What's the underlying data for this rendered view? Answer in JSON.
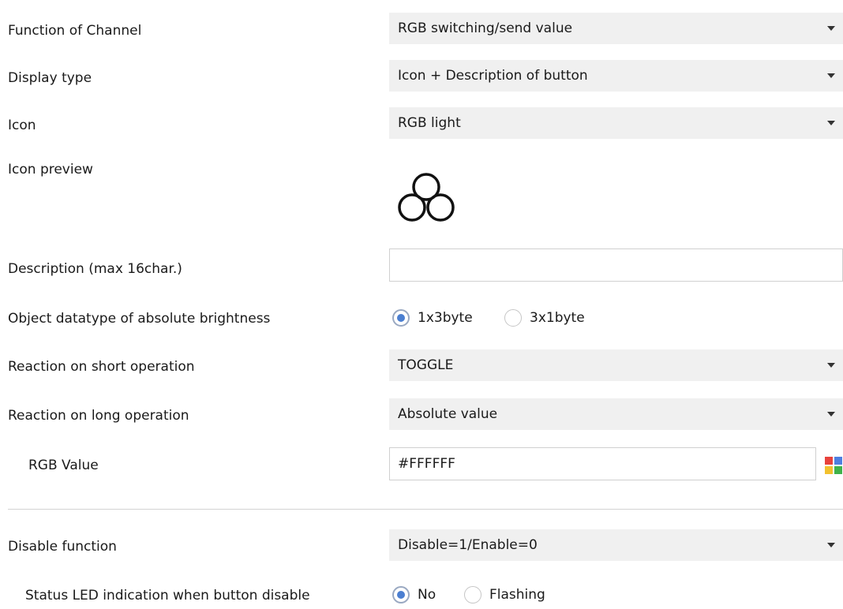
{
  "rows": {
    "function_of_channel": {
      "label": "Function of Channel",
      "value": "RGB switching/send value"
    },
    "display_type": {
      "label": "Display type",
      "value": "Icon + Description of button"
    },
    "icon": {
      "label": "Icon",
      "value": "RGB light"
    },
    "icon_preview": {
      "label": "Icon preview",
      "icon": "rgb-light-icon"
    },
    "description": {
      "label": "Description (max 16char.)",
      "value": ""
    },
    "object_datatype": {
      "label": "Object datatype of absolute brightness",
      "options": [
        "1x3byte",
        "3x1byte"
      ],
      "selected": "1x3byte"
    },
    "reaction_short": {
      "label": "Reaction on short operation",
      "value": "TOGGLE"
    },
    "reaction_long": {
      "label": "Reaction on long operation",
      "value": "Absolute value"
    },
    "rgb_value": {
      "label": "RGB Value",
      "value": "#FFFFFF",
      "picker_icon": "color-palette-icon",
      "picker_colors": [
        "#e8423c",
        "#4d7fe0",
        "#f2c12e",
        "#3fb24a"
      ]
    },
    "disable_function": {
      "label": "Disable function",
      "value": "Disable=1/Enable=0"
    },
    "status_led": {
      "label": "Status LED indication when button disable",
      "options": [
        "No",
        "Flashing"
      ],
      "selected": "No"
    }
  },
  "colors": {
    "dropdown_bg": "#f0f0f0",
    "radio_accent": "#4b7fd1",
    "divider": "#d3d3d3"
  }
}
